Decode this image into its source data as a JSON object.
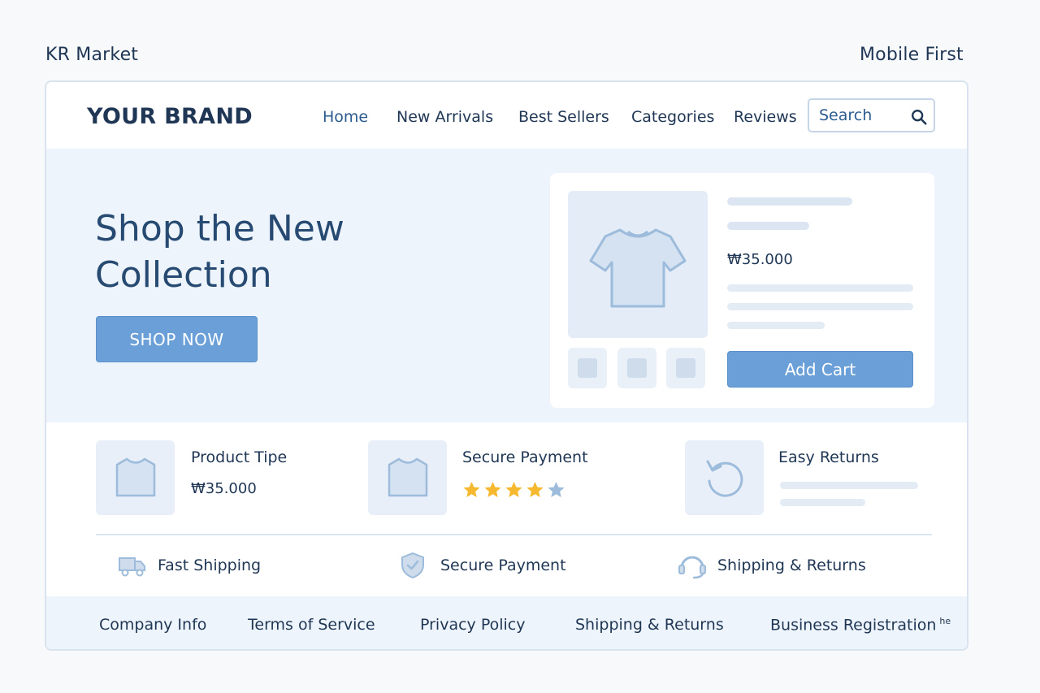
{
  "page": {
    "left_label": "KR Market",
    "right_label": "Mobile First"
  },
  "header": {
    "brand": "YOUR BRAND",
    "nav": [
      "Home",
      "New Arrivals",
      "Best Sellers",
      "Categories",
      "Reviews"
    ],
    "search_placeholder": "Search"
  },
  "hero": {
    "title_line1": "Shop the New",
    "title_line2": "Collection",
    "cta": "SHOP NOW"
  },
  "product_card": {
    "price": "₩35.000",
    "add_cart": "Add Cart"
  },
  "features": [
    {
      "title": "Product Tipe",
      "price": "₩35.000",
      "icon": "tshirt-icon"
    },
    {
      "title": "Secure Payment",
      "rating": 4,
      "rating_max": 5,
      "icon": "tshirt-icon"
    },
    {
      "title": "Easy Returns",
      "icon": "return-arrow-icon"
    }
  ],
  "badges": [
    {
      "label": "Fast Shipping",
      "icon": "truck-icon"
    },
    {
      "label": "Secure Payment",
      "icon": "shield-check-icon"
    },
    {
      "label": "Shipping & Returns",
      "icon": "headset-icon"
    }
  ],
  "footer": {
    "links": [
      "Company Info",
      "Terms of Service",
      "Privacy Policy",
      "Shipping & Returns",
      "Business Registration"
    ],
    "trailing": "he"
  },
  "colors": {
    "accent": "#6a9fd7",
    "text": "#1f3654",
    "hero_bg": "#eef4fb",
    "star": "#f5b82e"
  }
}
